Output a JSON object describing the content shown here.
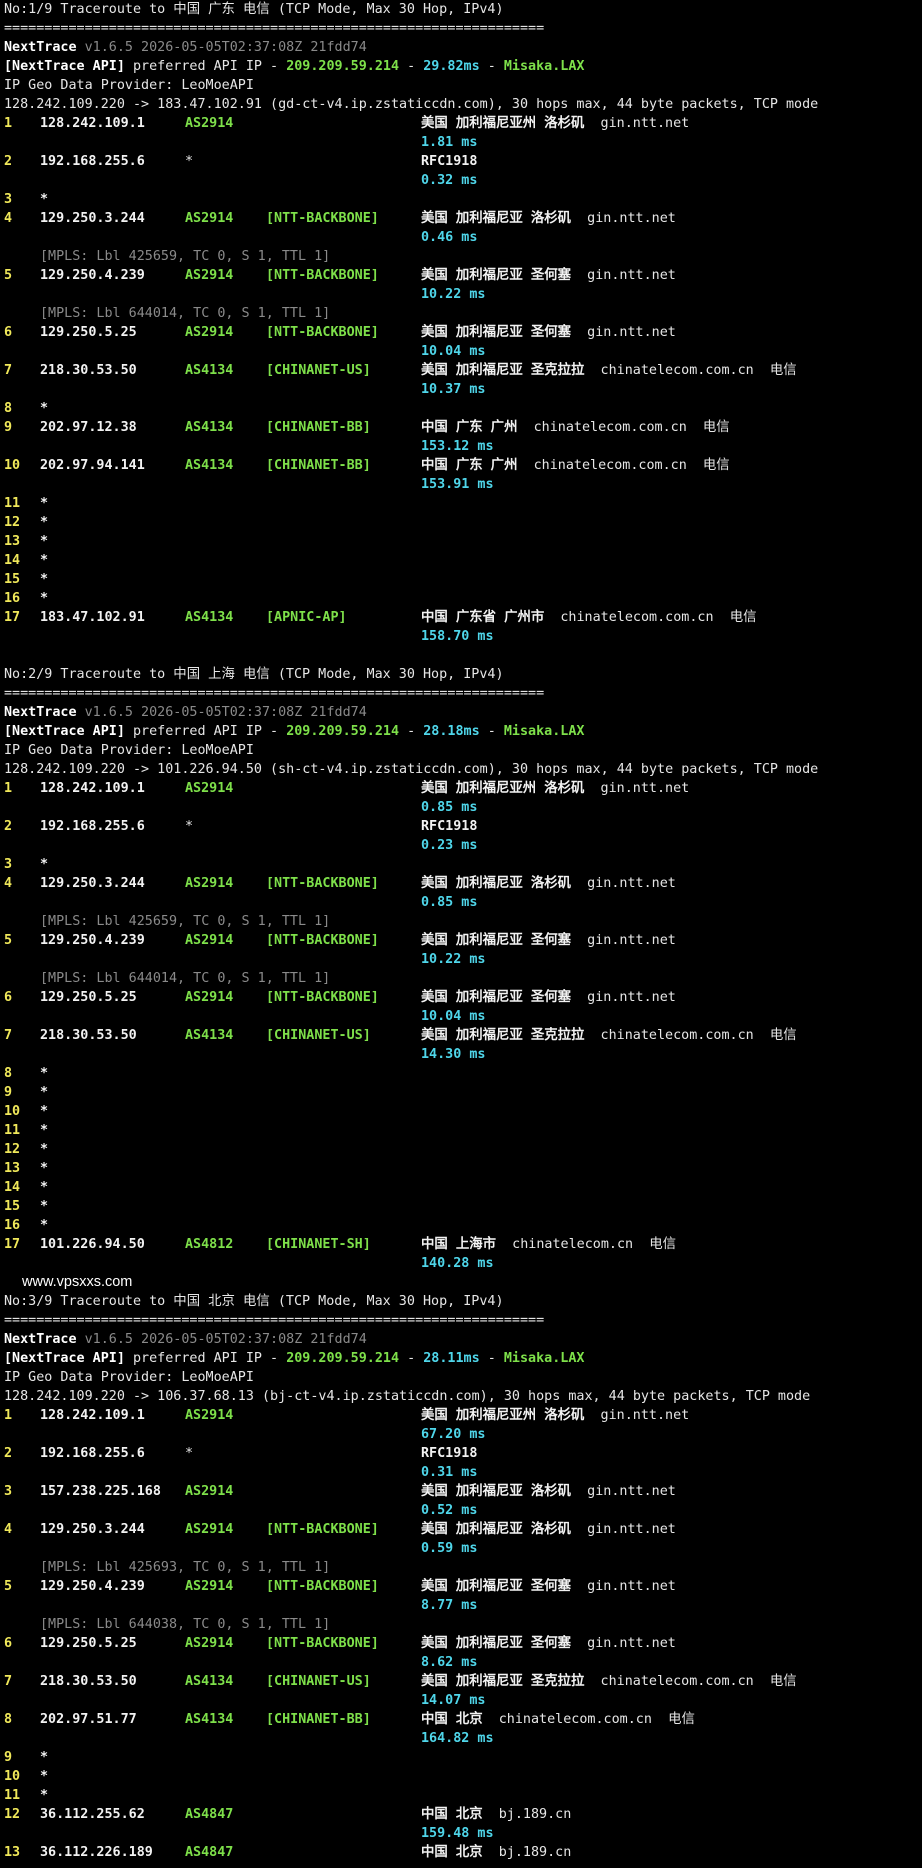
{
  "watermark": "www.vpsxxs.com",
  "sections": [
    {
      "title": "No:1/9 Traceroute to 中国 广东 电信 (TCP Mode, Max 30 Hop, IPv4)",
      "separator": "===================================================================",
      "nexttrace": {
        "name": "NextTrace",
        "version": "v1.6.5 2026-05-05T02:37:08Z 21fdd74"
      },
      "api": {
        "tag": "[NextTrace API]",
        "text": "preferred API IP -",
        "ip": "209.209.59.214",
        "dash": "-",
        "ms": "29.82ms",
        "dash2": "-",
        "node": "Misaka.LAX"
      },
      "provider": "IP Geo Data Provider: LeoMoeAPI",
      "route": "128.242.109.220 -> 183.47.102.91 (gd-ct-v4.ip.zstaticcdn.com), 30 hops max, 44 byte packets, TCP mode",
      "hops": [
        {
          "hop": "1",
          "ip": "128.242.109.1",
          "as": "AS2914",
          "tag": "",
          "geo": "美国 加利福尼亚州 洛杉矶",
          "domain": "gin.ntt.net",
          "isp": "",
          "rtt": "1.81 ms"
        },
        {
          "hop": "2",
          "ip": "192.168.255.6",
          "asw": "*",
          "geo": "RFC1918",
          "rtt": "0.32 ms"
        },
        {
          "hop": "3",
          "ip": "*"
        },
        {
          "hop": "4",
          "ip": "129.250.3.244",
          "as": "AS2914",
          "tag": "[NTT-BACKBONE]",
          "geo": "美国 加利福尼亚 洛杉矶",
          "domain": "gin.ntt.net",
          "rtt": "0.46 ms",
          "mpls": "[MPLS: Lbl 425659, TC 0, S 1, TTL 1]"
        },
        {
          "hop": "5",
          "ip": "129.250.4.239",
          "as": "AS2914",
          "tag": "[NTT-BACKBONE]",
          "geo": "美国 加利福尼亚 圣何塞",
          "domain": "gin.ntt.net",
          "rtt": "10.22 ms",
          "mpls": "[MPLS: Lbl 644014, TC 0, S 1, TTL 1]"
        },
        {
          "hop": "6",
          "ip": "129.250.5.25",
          "as": "AS2914",
          "tag": "[NTT-BACKBONE]",
          "geo": "美国 加利福尼亚 圣何塞",
          "domain": "gin.ntt.net",
          "rtt": "10.04 ms"
        },
        {
          "hop": "7",
          "ip": "218.30.53.50",
          "as": "AS4134",
          "tag": "[CHINANET-US]",
          "geo": "美国 加利福尼亚 圣克拉拉",
          "domain": "chinatelecom.com.cn",
          "isp": "电信",
          "rtt": "10.37 ms"
        },
        {
          "hop": "8",
          "ip": "*"
        },
        {
          "hop": "9",
          "ip": "202.97.12.38",
          "as": "AS4134",
          "tag": "[CHINANET-BB]",
          "geo": "中国 广东 广州",
          "domain": "chinatelecom.com.cn",
          "isp": "电信",
          "rtt": "153.12 ms"
        },
        {
          "hop": "10",
          "ip": "202.97.94.141",
          "as": "AS4134",
          "tag": "[CHINANET-BB]",
          "geo": "中国 广东 广州",
          "domain": "chinatelecom.com.cn",
          "isp": "电信",
          "rtt": "153.91 ms"
        },
        {
          "hop": "11",
          "ip": "*"
        },
        {
          "hop": "12",
          "ip": "*"
        },
        {
          "hop": "13",
          "ip": "*"
        },
        {
          "hop": "14",
          "ip": "*"
        },
        {
          "hop": "15",
          "ip": "*"
        },
        {
          "hop": "16",
          "ip": "*"
        },
        {
          "hop": "17",
          "ip": "183.47.102.91",
          "as": "AS4134",
          "tag": "[APNIC-AP]",
          "geo": "中国 广东省 广州市",
          "domain": "chinatelecom.com.cn",
          "isp": "电信",
          "rtt": "158.70 ms"
        }
      ]
    },
    {
      "title": "No:2/9 Traceroute to 中国 上海 电信 (TCP Mode, Max 30 Hop, IPv4)",
      "separator": "===================================================================",
      "nexttrace": {
        "name": "NextTrace",
        "version": "v1.6.5 2026-05-05T02:37:08Z 21fdd74"
      },
      "api": {
        "tag": "[NextTrace API]",
        "text": "preferred API IP -",
        "ip": "209.209.59.214",
        "dash": "-",
        "ms": "28.18ms",
        "dash2": "-",
        "node": "Misaka.LAX"
      },
      "provider": "IP Geo Data Provider: LeoMoeAPI",
      "route": "128.242.109.220 -> 101.226.94.50 (sh-ct-v4.ip.zstaticcdn.com), 30 hops max, 44 byte packets, TCP mode",
      "hops": [
        {
          "hop": "1",
          "ip": "128.242.109.1",
          "as": "AS2914",
          "tag": "",
          "geo": "美国 加利福尼亚州 洛杉矶",
          "domain": "gin.ntt.net",
          "rtt": "0.85 ms"
        },
        {
          "hop": "2",
          "ip": "192.168.255.6",
          "asw": "*",
          "geo": "RFC1918",
          "rtt": "0.23 ms"
        },
        {
          "hop": "3",
          "ip": "*"
        },
        {
          "hop": "4",
          "ip": "129.250.3.244",
          "as": "AS2914",
          "tag": "[NTT-BACKBONE]",
          "geo": "美国 加利福尼亚 洛杉矶",
          "domain": "gin.ntt.net",
          "rtt": "0.85 ms",
          "mpls": "[MPLS: Lbl 425659, TC 0, S 1, TTL 1]"
        },
        {
          "hop": "5",
          "ip": "129.250.4.239",
          "as": "AS2914",
          "tag": "[NTT-BACKBONE]",
          "geo": "美国 加利福尼亚 圣何塞",
          "domain": "gin.ntt.net",
          "rtt": "10.22 ms",
          "mpls": "[MPLS: Lbl 644014, TC 0, S 1, TTL 1]"
        },
        {
          "hop": "6",
          "ip": "129.250.5.25",
          "as": "AS2914",
          "tag": "[NTT-BACKBONE]",
          "geo": "美国 加利福尼亚 圣何塞",
          "domain": "gin.ntt.net",
          "rtt": "10.04 ms"
        },
        {
          "hop": "7",
          "ip": "218.30.53.50",
          "as": "AS4134",
          "tag": "[CHINANET-US]",
          "geo": "美国 加利福尼亚 圣克拉拉",
          "domain": "chinatelecom.com.cn",
          "isp": "电信",
          "rtt": "14.30 ms"
        },
        {
          "hop": "8",
          "ip": "*"
        },
        {
          "hop": "9",
          "ip": "*"
        },
        {
          "hop": "10",
          "ip": "*"
        },
        {
          "hop": "11",
          "ip": "*"
        },
        {
          "hop": "12",
          "ip": "*"
        },
        {
          "hop": "13",
          "ip": "*"
        },
        {
          "hop": "14",
          "ip": "*"
        },
        {
          "hop": "15",
          "ip": "*"
        },
        {
          "hop": "16",
          "ip": "*"
        },
        {
          "hop": "17",
          "ip": "101.226.94.50",
          "as": "AS4812",
          "tag": "[CHINANET-SH]",
          "geo": "中国 上海市",
          "domain": "chinatelecom.cn",
          "isp": "电信",
          "rtt": "140.28 ms"
        }
      ]
    },
    {
      "title": "No:3/9 Traceroute to 中国 北京 电信 (TCP Mode, Max 30 Hop, IPv4)",
      "separator": "===================================================================",
      "nexttrace": {
        "name": "NextTrace",
        "version": "v1.6.5 2026-05-05T02:37:08Z 21fdd74"
      },
      "api": {
        "tag": "[NextTrace API]",
        "text": "preferred API IP -",
        "ip": "209.209.59.214",
        "dash": "-",
        "ms": "28.11ms",
        "dash2": "-",
        "node": "Misaka.LAX"
      },
      "provider": "IP Geo Data Provider: LeoMoeAPI",
      "route": "128.242.109.220 -> 106.37.68.13 (bj-ct-v4.ip.zstaticcdn.com), 30 hops max, 44 byte packets, TCP mode",
      "hops": [
        {
          "hop": "1",
          "ip": "128.242.109.1",
          "as": "AS2914",
          "tag": "",
          "geo": "美国 加利福尼亚州 洛杉矶",
          "domain": "gin.ntt.net",
          "rtt": "67.20 ms"
        },
        {
          "hop": "2",
          "ip": "192.168.255.6",
          "asw": "*",
          "geo": "RFC1918",
          "rtt": "0.31 ms"
        },
        {
          "hop": "3",
          "ip": "157.238.225.168",
          "as": "AS2914",
          "tag": "",
          "geo": "美国 加利福尼亚 洛杉矶",
          "domain": "gin.ntt.net",
          "rtt": "0.52 ms"
        },
        {
          "hop": "4",
          "ip": "129.250.3.244",
          "as": "AS2914",
          "tag": "[NTT-BACKBONE]",
          "geo": "美国 加利福尼亚 洛杉矶",
          "domain": "gin.ntt.net",
          "rtt": "0.59 ms",
          "mpls": "[MPLS: Lbl 425693, TC 0, S 1, TTL 1]"
        },
        {
          "hop": "5",
          "ip": "129.250.4.239",
          "as": "AS2914",
          "tag": "[NTT-BACKBONE]",
          "geo": "美国 加利福尼亚 圣何塞",
          "domain": "gin.ntt.net",
          "rtt": "8.77 ms",
          "mpls": "[MPLS: Lbl 644038, TC 0, S 1, TTL 1]"
        },
        {
          "hop": "6",
          "ip": "129.250.5.25",
          "as": "AS2914",
          "tag": "[NTT-BACKBONE]",
          "geo": "美国 加利福尼亚 圣何塞",
          "domain": "gin.ntt.net",
          "rtt": "8.62 ms"
        },
        {
          "hop": "7",
          "ip": "218.30.53.50",
          "as": "AS4134",
          "tag": "[CHINANET-US]",
          "geo": "美国 加利福尼亚 圣克拉拉",
          "domain": "chinatelecom.com.cn",
          "isp": "电信",
          "rtt": "14.07 ms"
        },
        {
          "hop": "8",
          "ip": "202.97.51.77",
          "as": "AS4134",
          "tag": "[CHINANET-BB]",
          "geo": "中国 北京",
          "domain": "chinatelecom.com.cn",
          "isp": "电信",
          "rtt": "164.82 ms"
        },
        {
          "hop": "9",
          "ip": "*"
        },
        {
          "hop": "10",
          "ip": "*"
        },
        {
          "hop": "11",
          "ip": "*"
        },
        {
          "hop": "12",
          "ip": "36.112.255.62",
          "as": "AS4847",
          "tag": "",
          "geo": "中国 北京",
          "domain": "bj.189.cn",
          "rtt": "159.48 ms"
        },
        {
          "hop": "13",
          "ip": "36.112.226.189",
          "as": "AS4847",
          "tag": "",
          "geo": "中国 北京",
          "domain": "bj.189.cn"
        }
      ]
    }
  ]
}
